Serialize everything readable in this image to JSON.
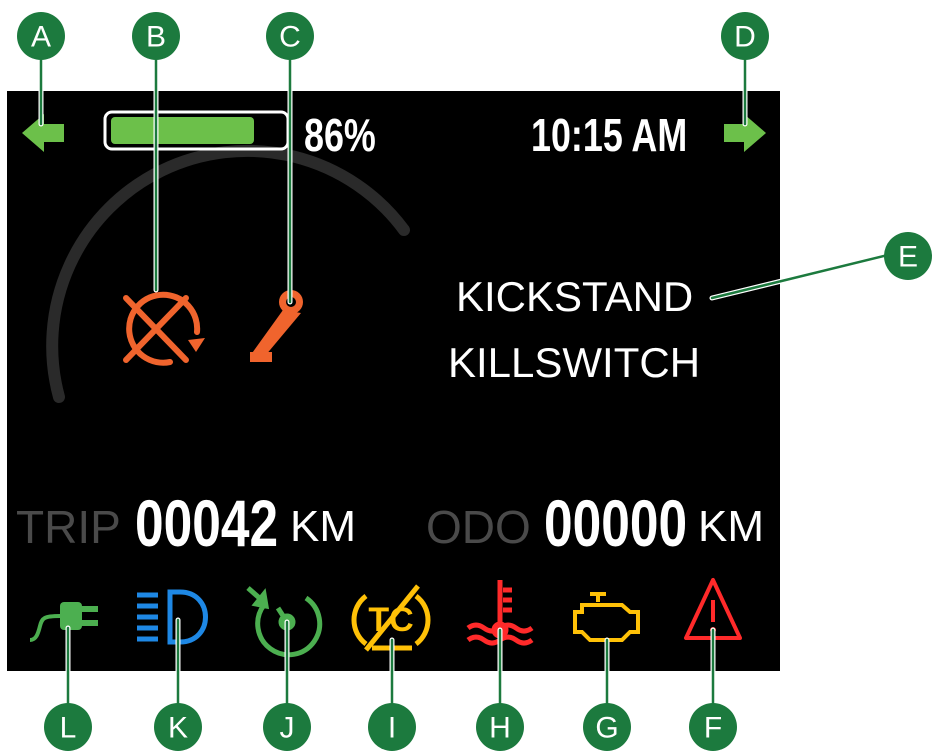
{
  "status_bar": {
    "battery_percent": "86%",
    "battery_level": 0.86,
    "time": "10:15 AM"
  },
  "warnings": [
    "KICKSTAND",
    "KILLSWITCH"
  ],
  "trip": {
    "label": "TRIP",
    "value": "00042",
    "unit": "KM"
  },
  "odo": {
    "label": "ODO",
    "value": "00000",
    "unit": "KM"
  },
  "indicators": [
    {
      "icon": "plug-charging-icon",
      "color": "#4caf50"
    },
    {
      "icon": "high-beam-icon",
      "color": "#1e88e5"
    },
    {
      "icon": "cruise-control-icon",
      "color": "#4caf50"
    },
    {
      "icon": "traction-control-off-icon",
      "color": "#ffc107"
    },
    {
      "icon": "coolant-temperature-icon",
      "color": "#ff2a2a"
    },
    {
      "icon": "check-engine-icon",
      "color": "#ffc107"
    },
    {
      "icon": "hazard-warning-icon",
      "color": "#ff2a2a"
    }
  ],
  "callouts": [
    "A",
    "B",
    "C",
    "D",
    "E",
    "F",
    "G",
    "H",
    "I",
    "J",
    "K",
    "L"
  ],
  "colors": {
    "callout_green": "#1c7a3e",
    "arrow_green": "#6cc04a",
    "warning_orange": "#f0642d",
    "battery_fill": "#6cc04a"
  }
}
